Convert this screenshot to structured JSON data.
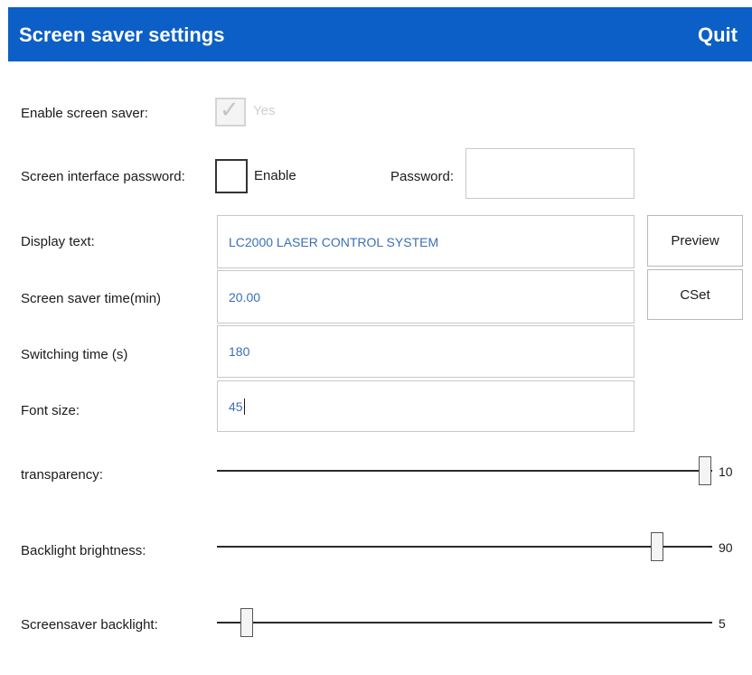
{
  "window": {
    "title": "Screen saver settings",
    "quit_label": "Quit"
  },
  "enable_screen_saver": {
    "label": "Enable screen saver:",
    "checked": true,
    "disabled": true,
    "option_label": "Yes"
  },
  "screen_password": {
    "label": "Screen interface password:",
    "checked": false,
    "enable_label": "Enable",
    "password_label": "Password:",
    "password_value": ""
  },
  "display_text": {
    "label": "Display text:",
    "value": "LC2000 LASER CONTROL SYSTEM",
    "preview_label": "Preview"
  },
  "screen_saver_time": {
    "label": "Screen saver time(min)",
    "value": "20.00",
    "cset_label": "CSet"
  },
  "switching_time": {
    "label": "Switching time (s)",
    "value": "180"
  },
  "font_size": {
    "label": "Font size:",
    "value": "45"
  },
  "sliders": {
    "transparency": {
      "label": "transparency:",
      "value": "10"
    },
    "backlight_brightness": {
      "label": "Backlight brightness:",
      "value": "90"
    },
    "screensaver_backlight": {
      "label": "Screensaver backlight:",
      "value": "5"
    }
  },
  "colors": {
    "titlebar": "#0c5fc6",
    "input_text": "#3a6fb5"
  },
  "icons": {
    "checkmark": "checkmark-icon"
  }
}
